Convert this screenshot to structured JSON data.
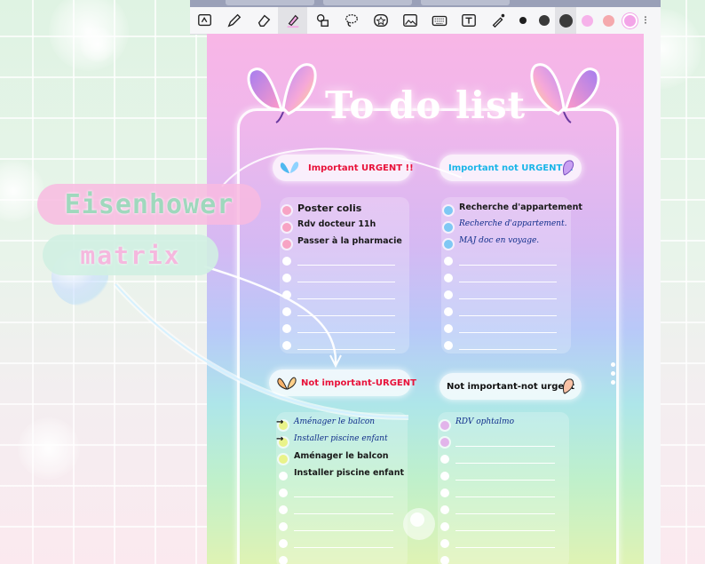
{
  "toolbar": {
    "tools": [
      {
        "icon": "lasso-select-icon"
      },
      {
        "icon": "pen-icon"
      },
      {
        "icon": "eraser-icon"
      },
      {
        "icon": "highlighter-icon"
      },
      {
        "icon": "shapes-icon"
      },
      {
        "icon": "lasso-icon"
      },
      {
        "icon": "sticker-icon"
      },
      {
        "icon": "image-icon"
      },
      {
        "icon": "keyboard-icon"
      },
      {
        "icon": "text-box-icon"
      },
      {
        "icon": "laser-pointer-icon"
      }
    ],
    "colors": [
      "#1f1f1f",
      "#3a3a3a",
      "#3a3a3a",
      "#f6b2ea",
      "#f5a9ad",
      "#f3a5e8"
    ],
    "more_label": "⁝"
  },
  "overlay": {
    "line1": "Eisenhower",
    "line2": "matrix"
  },
  "page": {
    "title": "To do list",
    "quadrants": [
      {
        "label": "Important URGENT !!",
        "label_color": "#e8123a",
        "bullet_color": "#f7a3c4",
        "items": [
          {
            "text": "Poster colis",
            "style": "bold-large",
            "filled": true
          },
          {
            "text": "Rdv docteur 11h",
            "style": "bold",
            "filled": true
          },
          {
            "text": "Passer à la pharmacie",
            "style": "bold",
            "filled": true
          },
          {
            "text": "",
            "filled": false
          },
          {
            "text": "",
            "filled": false
          },
          {
            "text": "",
            "filled": false
          },
          {
            "text": "",
            "filled": false
          },
          {
            "text": "",
            "filled": false
          },
          {
            "text": "",
            "filled": false
          }
        ]
      },
      {
        "label": "Important not URGENT !!",
        "label_color": "#1ab5e8",
        "bullet_color": "#7fc8f4",
        "items": [
          {
            "text": "Recherche d'appartement",
            "style": "bold",
            "filled": true
          },
          {
            "text": "Recherche d'appartement.",
            "style": "hand",
            "filled": true
          },
          {
            "text": "MAJ doc en voyage.",
            "style": "hand",
            "filled": true
          },
          {
            "text": "",
            "filled": false
          },
          {
            "text": "",
            "filled": false
          },
          {
            "text": "",
            "filled": false
          },
          {
            "text": "",
            "filled": false
          },
          {
            "text": "",
            "filled": false
          },
          {
            "text": "",
            "filled": false
          }
        ]
      },
      {
        "label": "Not important-URGENT",
        "label_color": "#e8123a",
        "bullet_color": "#e9f38a",
        "items": [
          {
            "text": "Aménager le balcon",
            "style": "hand",
            "filled": true,
            "arrow": "→"
          },
          {
            "text": "Installer piscine enfant",
            "style": "hand",
            "filled": true,
            "arrow": "→"
          },
          {
            "text": "Aménager le balcon",
            "style": "bold",
            "filled": true
          },
          {
            "text": "Installer piscine enfant",
            "style": "bold",
            "filled": false
          },
          {
            "text": "",
            "filled": false
          },
          {
            "text": "",
            "filled": false
          },
          {
            "text": "",
            "filled": false
          },
          {
            "text": "",
            "filled": false
          },
          {
            "text": "",
            "filled": false
          }
        ]
      },
      {
        "label": "Not important-not urgent",
        "label_color": "#111111",
        "bullet_color": "#e2b4ea",
        "items": [
          {
            "text": "RDV ophtalmo",
            "style": "hand",
            "filled": true
          },
          {
            "text": "",
            "filled": true
          },
          {
            "text": "",
            "filled": false
          },
          {
            "text": "",
            "filled": false
          },
          {
            "text": "",
            "filled": false
          },
          {
            "text": "",
            "filled": false
          },
          {
            "text": "",
            "filled": false
          },
          {
            "text": "",
            "filled": false
          },
          {
            "text": "",
            "filled": false
          }
        ]
      }
    ]
  }
}
